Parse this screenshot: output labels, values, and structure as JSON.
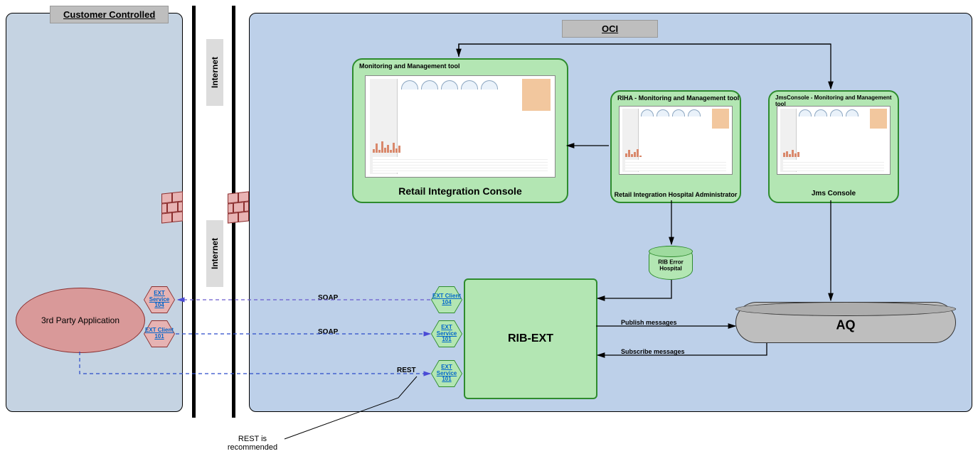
{
  "regions": {
    "customer_controlled": {
      "title": "Customer Controlled"
    },
    "oci": {
      "title": "OCI"
    }
  },
  "internet_labels": {
    "top": "Internet",
    "bottom": "Internet"
  },
  "tools": {
    "ric": {
      "title": "Monitoring and Management tool",
      "footer": "Retail Integration Console"
    },
    "riha": {
      "title": "RIHA - Monitoring and Management tool",
      "footer": "Retail Integration Hospital Administrator"
    },
    "jms": {
      "title": "JmsConsole - Monitoring and Management tool",
      "footer": "Jms Console"
    }
  },
  "nodes": {
    "rib_ext": "RIB-EXT",
    "aq": "AQ",
    "rib_error_hospital": "RIB Error Hospital",
    "third_party": "3rd Party Application"
  },
  "hex": {
    "ext_client_104_green": "EXT Client 104",
    "ext_service_101_green": "EXT Service 101",
    "ext_service_101_green_b": "EXT Service 101",
    "ext_service_104_pink": "EXT Service 104",
    "ext_client_101_pink": "EXT Client 101"
  },
  "protocols": {
    "soap1": "SOAP",
    "soap2": "SOAP",
    "rest": "REST"
  },
  "edge_labels": {
    "publish": "Publish messages",
    "subscribe": "Subscribe messages"
  },
  "annotation": {
    "rest_rec": "REST is recommended"
  }
}
